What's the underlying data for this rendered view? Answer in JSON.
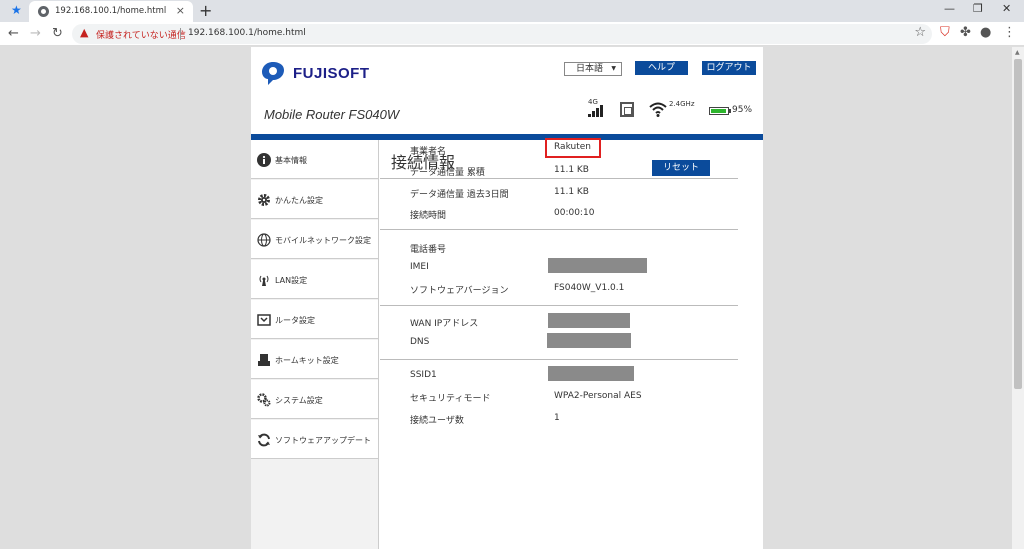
{
  "browser": {
    "tab_title": "192.168.100.1/home.html",
    "tab_close": "×",
    "new_tab": "+",
    "security_warning": "保護されていない通信",
    "url": "192.168.100.1/home.html",
    "window_controls": [
      "—",
      "❐",
      "✕"
    ]
  },
  "header": {
    "brand": "FUJISOFT",
    "language": "日本語",
    "help_button": "ヘルプ",
    "logout_button": "ログアウト",
    "model": "Mobile Router FS040W",
    "network_type": "4G",
    "wifi_band": "2.4GHz",
    "battery": "95%",
    "battery_level": 0.95
  },
  "sidebar": {
    "items": [
      {
        "label": "基本情報",
        "icon": "info-icon"
      },
      {
        "label": "かんたん設定",
        "icon": "gear-icon"
      },
      {
        "label": "モバイルネットワーク設定",
        "icon": "globe-icon"
      },
      {
        "label": "LAN設定",
        "icon": "antenna-icon"
      },
      {
        "label": "ルータ設定",
        "icon": "router-icon"
      },
      {
        "label": "ホームキット設定",
        "icon": "homekit-icon"
      },
      {
        "label": "システム設定",
        "icon": "gears-icon"
      },
      {
        "label": "ソフトウェアアップデート",
        "icon": "refresh-icon"
      }
    ]
  },
  "content": {
    "title": "接続情報",
    "provider_label": "事業者名",
    "provider_value": "Rakuten",
    "reset_button": "リセット",
    "data_total_label": "データ通信量 累積",
    "data_total_value": "11.1 KB",
    "data_3day_label": "データ通信量 過去3日間",
    "data_3day_value": "11.1 KB",
    "conn_time_label": "接続時間",
    "conn_time_value": "00:00:10",
    "phone_label": "電話番号",
    "imei_label": "IMEI",
    "sw_version_label": "ソフトウェアバージョン",
    "sw_version_value": "FS040W_V1.0.1",
    "wan_ip_label": "WAN IPアドレス",
    "dns_label": "DNS",
    "ssid_label": "SSID1",
    "security_mode_label": "セキュリティモード",
    "security_mode_value": "WPA2-Personal AES",
    "users_label": "接続ユーザ数",
    "users_value": "1"
  }
}
